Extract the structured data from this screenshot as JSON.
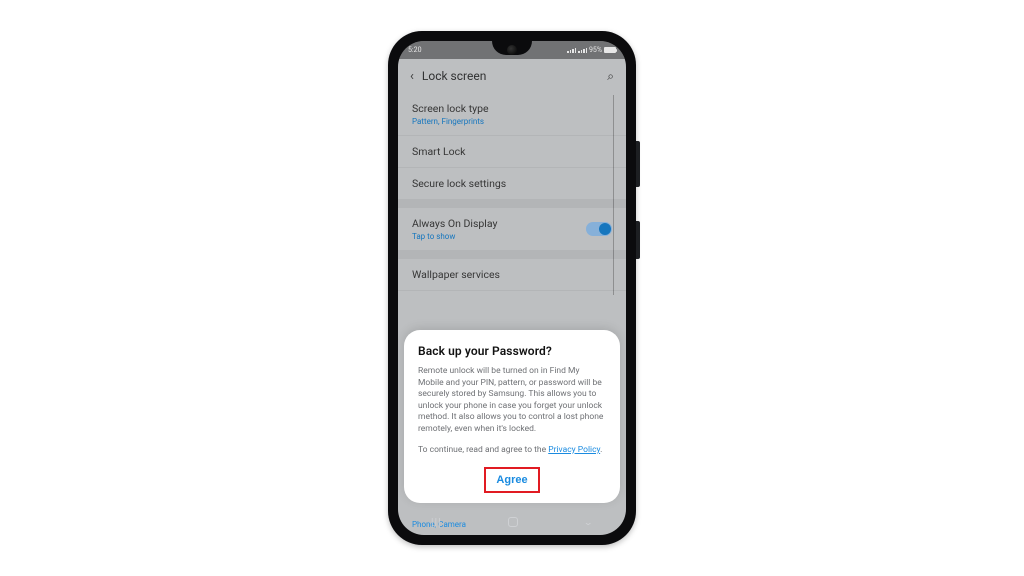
{
  "status": {
    "time": "5:20",
    "battery_pct": "95%"
  },
  "appbar": {
    "title": "Lock screen"
  },
  "rows": {
    "screen_lock_type": {
      "label": "Screen lock type",
      "sub": "Pattern, Fingerprints"
    },
    "smart_lock": {
      "label": "Smart Lock"
    },
    "secure_lock_settings": {
      "label": "Secure lock settings"
    },
    "always_on_display": {
      "label": "Always On Display",
      "sub": "Tap to show"
    },
    "wallpaper_services": {
      "label": "Wallpaper services"
    },
    "truncated_sub": "Phone, Camera"
  },
  "dialog": {
    "title": "Back up your Password?",
    "body": "Remote unlock will be turned on in Find My Mobile and your PIN, pattern, or password will be securely stored by Samsung. This allows you to unlock your phone in case you forget your unlock method. It also allows you to control a lost phone remotely, even when it's locked.",
    "continue_prefix": "To continue, read and agree to the ",
    "privacy_link": "Privacy Policy",
    "continue_suffix": ".",
    "agree": "Agree"
  },
  "icons": {
    "back": "‹",
    "search": "⌕",
    "nav_recent": "|||",
    "nav_back": "⌄"
  }
}
